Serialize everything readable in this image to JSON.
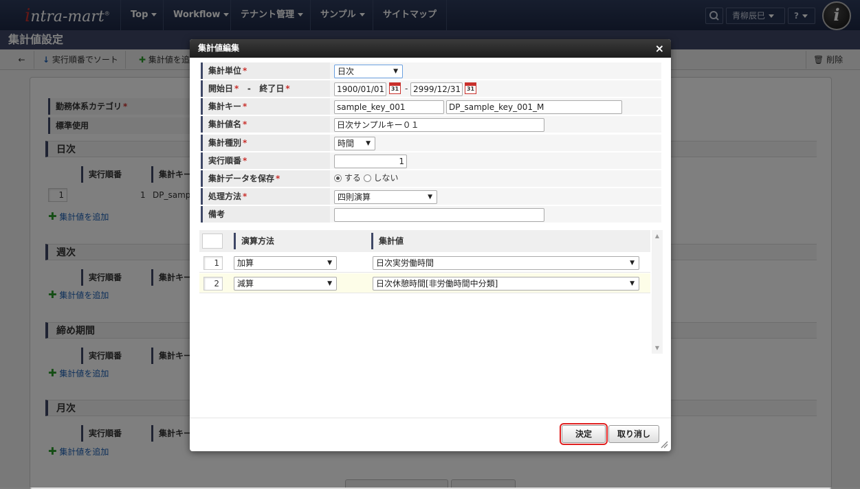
{
  "nav": {
    "logo_i": "i",
    "logo_rest": "ntra-mart",
    "logo_tm": "®",
    "items": [
      {
        "label": "Top"
      },
      {
        "label": "Workflow"
      },
      {
        "label": "テナント管理"
      },
      {
        "label": "サンプル"
      },
      {
        "label": "サイトマップ"
      }
    ],
    "user": "青柳辰巳",
    "help": "?",
    "avatar_letter": "i"
  },
  "page": {
    "title": "集計値設定",
    "toolbar": {
      "back": "←",
      "sort": "実行順番でソート",
      "add": "集計値を追加",
      "delete": "削除"
    },
    "props": [
      "勤務体系カテゴリ",
      "標準使用"
    ],
    "required_mark": "*",
    "sections": [
      {
        "title": "日次",
        "col1": "実行順番",
        "col2": "集計キー",
        "row_no": "1",
        "row_order": "1",
        "row_key": "DP_samp",
        "add": "集計値を追加"
      },
      {
        "title": "週次",
        "col1": "実行順番",
        "col2": "集計キー",
        "add": "集計値を追加"
      },
      {
        "title": "締め期間",
        "col1": "実行順番",
        "col2": "集計キー",
        "add": "集計値を追加"
      },
      {
        "title": "月次",
        "col1": "実行順番",
        "col2": "集計キー",
        "add": "集計値を追加"
      }
    ]
  },
  "dialog": {
    "title": "集計値編集",
    "close": "×",
    "fields": {
      "unit_label": "集計単位",
      "unit_value": "日次",
      "start_label": "開始日",
      "dash": "-",
      "end_label": "終了日",
      "start_value": "1900/01/01",
      "end_value": "2999/12/31",
      "cal_day": "31",
      "key_label": "集計キー",
      "key_value": "sample_key_001",
      "key_name_value": "DP_sample_key_001_M",
      "name_label": "集計値名",
      "name_value": "日次サンプルキー０１",
      "type_label": "集計種別",
      "type_value": "時間",
      "order_label": "実行順番",
      "order_value": "1",
      "save_label": "集計データを保存",
      "save_yes": "する",
      "save_no": "しない",
      "method_label": "処理方法",
      "method_value": "四則演算",
      "note_label": "備考",
      "note_value": ""
    },
    "grid": {
      "col_op": "演算方法",
      "col_value": "集計値",
      "rows": [
        {
          "no": "1",
          "op": "加算",
          "value": "日次実労働時間"
        },
        {
          "no": "2",
          "op": "減算",
          "value": "日次休憩時間[非労働時間中分類]"
        }
      ]
    },
    "ok": "決定",
    "cancel": "取り消し"
  },
  "colors": {
    "header": "#2e3c5d",
    "accent_border": "#3e4766",
    "required": "#c9302c",
    "highlight": "#e02020",
    "add_icon": "#2b9b2b"
  },
  "icons": [
    "back-arrow-icon",
    "sort-icon",
    "plus-icon",
    "trash-icon",
    "search-icon",
    "calendar-icon",
    "close-icon",
    "resize-grip-icon"
  ]
}
